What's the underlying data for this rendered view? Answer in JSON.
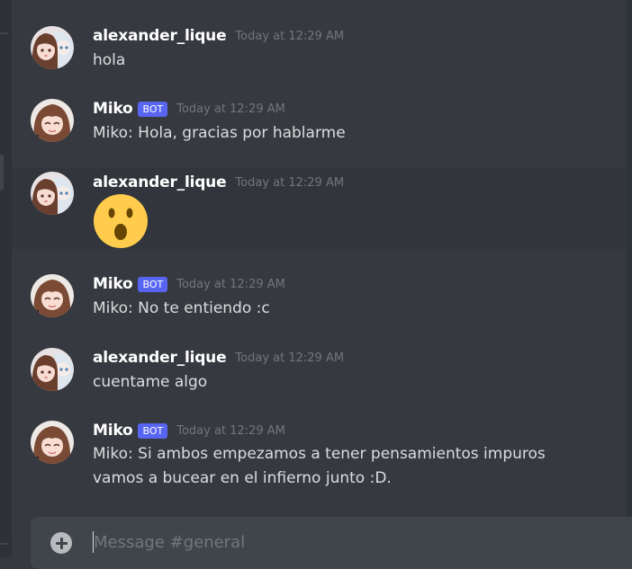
{
  "channel": {
    "composer_placeholder": "Message #general"
  },
  "messages": [
    {
      "username": "alexander_lique",
      "bot": false,
      "timestamp": "Today at 12:29 AM",
      "text": "hola"
    },
    {
      "username": "Miko",
      "bot": true,
      "badge": "BOT",
      "timestamp": "Today at 12:29 AM",
      "text": "Miko: Hola, gracias por hablarme"
    },
    {
      "username": "alexander_lique",
      "bot": false,
      "timestamp": "Today at 12:29 AM",
      "emoji": "open-mouth-emoji"
    },
    {
      "username": "Miko",
      "bot": true,
      "badge": "BOT",
      "timestamp": "Today at 12:29 AM",
      "text": "Miko: No te entiendo :c"
    },
    {
      "username": "alexander_lique",
      "bot": false,
      "timestamp": "Today at 12:29 AM",
      "text": "cuentame algo"
    },
    {
      "username": "Miko",
      "bot": true,
      "badge": "BOT",
      "timestamp": "Today at 12:29 AM",
      "lines": [
        "Miko: Si ambos empezamos a tener pensamientos impuros",
        "vamos a bucear en el infierno junto :D."
      ]
    }
  ],
  "colors": {
    "background": "#36393f",
    "bot_badge": "#5865f2",
    "username": "#ffffff",
    "timestamp": "#72767d"
  }
}
